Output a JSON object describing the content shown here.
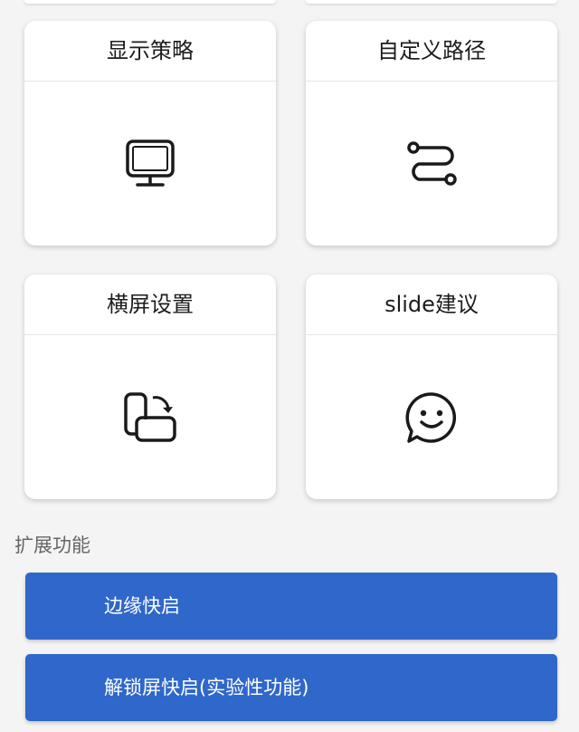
{
  "cards": [
    {
      "title": "显示策略",
      "icon": "monitor-icon"
    },
    {
      "title": "自定义路径",
      "icon": "route-path-icon"
    },
    {
      "title": "横屏设置",
      "icon": "rotate-screen-icon"
    },
    {
      "title": "slide建议",
      "icon": "smiley-chat-icon"
    }
  ],
  "section": {
    "title": "扩展功能"
  },
  "buttons": [
    {
      "label": "边缘快启"
    },
    {
      "label": "解锁屏快启(实验性功能)"
    }
  ],
  "colors": {
    "accent": "#2f67ca",
    "background": "#f4f4f4",
    "card": "#ffffff"
  }
}
